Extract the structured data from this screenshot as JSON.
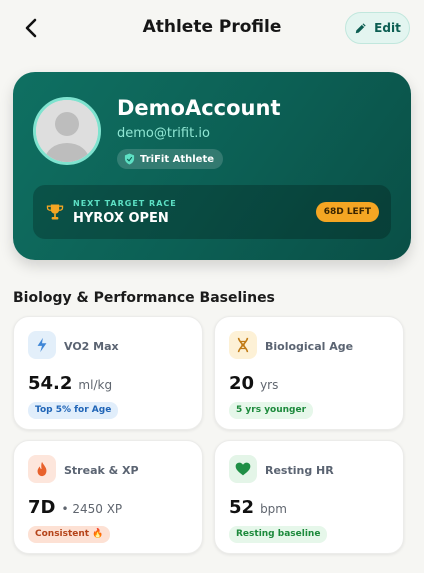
{
  "header": {
    "title": "Athlete Profile",
    "edit_label": "Edit"
  },
  "profile": {
    "name": "DemoAccount",
    "email": "demo@trifit.io",
    "tier": "TriFit Athlete",
    "race_caption": "NEXT TARGET RACE",
    "race_name": "HYROX OPEN",
    "days_left": "68D LEFT"
  },
  "section_title": "Biology & Performance Baselines",
  "metrics": [
    {
      "label": "VO2 Max",
      "value": "54.2",
      "unit": "ml/kg",
      "badge": "Top 5% for Age",
      "icon": "lightning-icon"
    },
    {
      "label": "Biological Age",
      "value": "20",
      "unit": "yrs",
      "badge": "5 yrs younger",
      "icon": "dna-icon"
    },
    {
      "label": "Streak & XP",
      "value": "7D",
      "unit": "• 2450 XP",
      "badge": "Consistent 🔥",
      "icon": "flame-icon"
    },
    {
      "label": "Resting HR",
      "value": "52",
      "unit": "bpm",
      "badge": "Resting baseline",
      "icon": "heart-icon"
    }
  ],
  "colors": {
    "brand": "#0c5f54",
    "accent": "#5de0c4",
    "warning": "#f5a623"
  }
}
